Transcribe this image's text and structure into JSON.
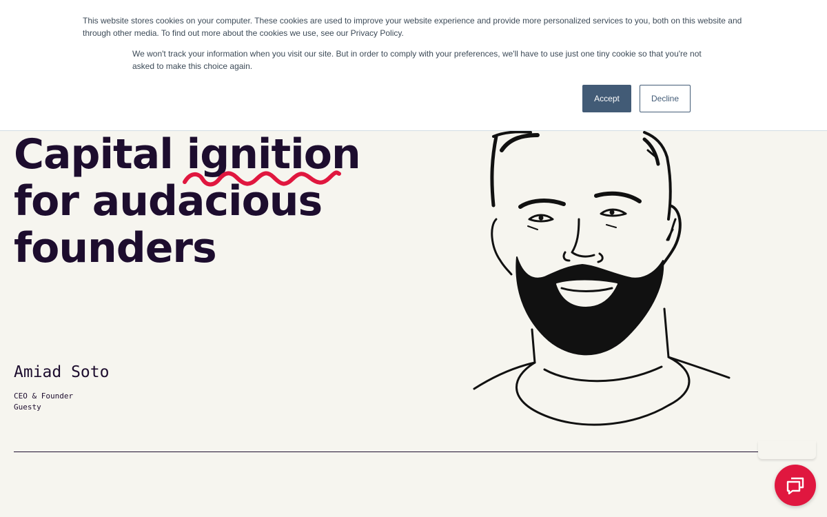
{
  "cookie_banner": {
    "text_main": "This website stores cookies on your computer. These cookies are used to improve your website experience and provide more personalized services to you, both on this website and through other media. To find out more about the cookies we use, see our Privacy Policy.",
    "text_secondary": "We won't track your information when you visit our site. But in order to comply with your preferences, we'll have to use just one tiny cookie so that you're not asked to make this choice again.",
    "accept_label": "Accept",
    "decline_label": "Decline"
  },
  "hero": {
    "line1_prefix": "Capital ",
    "line1_highlight": "ignition",
    "line2": "for audacious",
    "line3": "founders"
  },
  "testimonial": {
    "name": "Amiad Soto",
    "role": "CEO & Founder",
    "company": "Guesty"
  },
  "colors": {
    "accent": "#e0173f",
    "text_dark": "#1d0d2e",
    "button_primary": "#425b76",
    "background": "#f6f5ef"
  },
  "icons": {
    "chat": "chat-bubble-icon"
  }
}
